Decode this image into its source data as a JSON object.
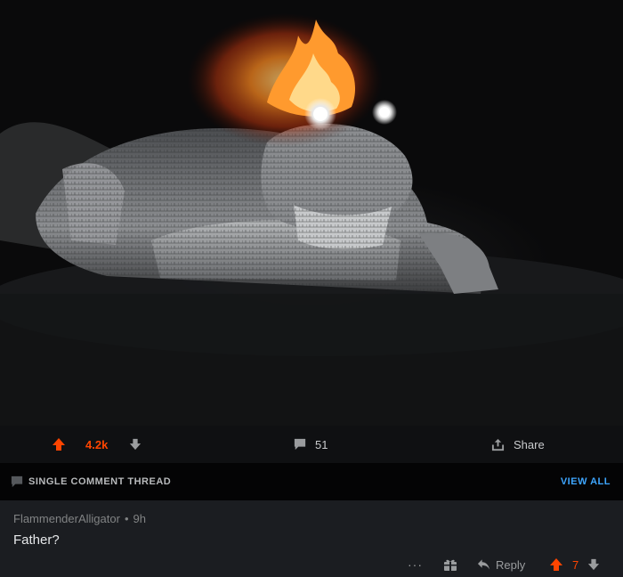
{
  "post": {
    "image_alt": "Alligator at night with glowing eyes and a flaming crown edited on its head",
    "actions": {
      "upvote_count": "4.2k",
      "comment_count": "51",
      "share_label": "Share"
    }
  },
  "thread": {
    "label": "SINGLE COMMENT THREAD",
    "view_all": "VIEW ALL"
  },
  "comment": {
    "author": "FlammenderAlligator",
    "separator": "•",
    "age": "9h",
    "text": "Father?",
    "more": "···",
    "reply_label": "Reply",
    "vote_count": "7"
  },
  "colors": {
    "upvote": "#ff4500",
    "link": "#3ea6ff",
    "comment_bg": "#1b1d21"
  }
}
